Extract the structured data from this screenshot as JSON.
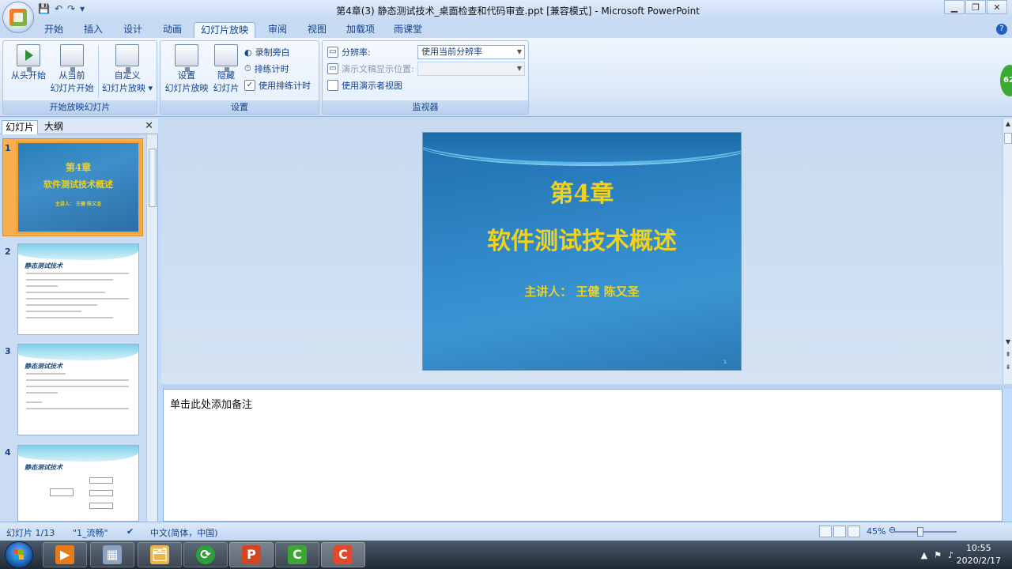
{
  "window": {
    "title": "第4章(3) 静态测试技术_桌面检查和代码审查.ppt [兼容模式] - Microsoft PowerPoint",
    "controls": [
      "▁",
      "❐",
      "✕"
    ]
  },
  "qat": {
    "save": "💾",
    "undo": "↶",
    "redo": "↷",
    "more": "▾"
  },
  "tabs": [
    "开始",
    "插入",
    "设计",
    "动画",
    "幻灯片放映",
    "审阅",
    "视图",
    "加载项",
    "雨课堂"
  ],
  "help": "?",
  "ribbon": {
    "group_start": {
      "label": "开始放映幻灯片",
      "from_beginning": "从头开始",
      "from_current_1": "从当前",
      "from_current_2": "幻灯片开始",
      "custom_1": "自定义",
      "custom_2": "幻灯片放映 ▾"
    },
    "group_setup": {
      "label": "设置",
      "setup_1": "设置",
      "setup_2": "幻灯片放映",
      "hide_1": "隐藏",
      "hide_2": "幻灯片",
      "record": "录制旁白",
      "rehearse": "排练计时",
      "use_timings": "使用排练计时"
    },
    "group_monitors": {
      "label": "监视器",
      "resolution": "分辨率:",
      "resolution_value": "使用当前分辨率",
      "show_on": "演示文稿显示位置:",
      "presenter_view": "使用演示者视图"
    }
  },
  "left_panel": {
    "tab_slides": "幻灯片",
    "tab_outline": "大纲",
    "close": "✕",
    "thumbs": [
      {
        "num": "1",
        "title1": "第4章",
        "title2": "软件测试技术概述",
        "sub": "主讲人：  王健   陈又圣"
      },
      {
        "num": "2",
        "title": "静态测试技术"
      },
      {
        "num": "3",
        "title": "静态测试技术"
      },
      {
        "num": "4",
        "title": "静态测试技术"
      }
    ]
  },
  "slide": {
    "line1": "第4章",
    "line2": "软件测试技术概述",
    "line3": "主讲人：  王健    陈又圣",
    "page": "1"
  },
  "notes": {
    "placeholder": "单击此处添加备注"
  },
  "status": {
    "slide_pos": "幻灯片 1/13",
    "theme": "\"1_流畅\"",
    "language": "中文(简体，中国)",
    "zoom": "45%"
  },
  "taskbar": {
    "apps": [
      "▶",
      "▦",
      "🗂",
      "⟳",
      "P",
      "C",
      "C"
    ],
    "tray_icons": [
      "▲",
      "⚑",
      "♪"
    ],
    "time": "10:55",
    "date": "2020/2/17"
  },
  "badge": "62"
}
